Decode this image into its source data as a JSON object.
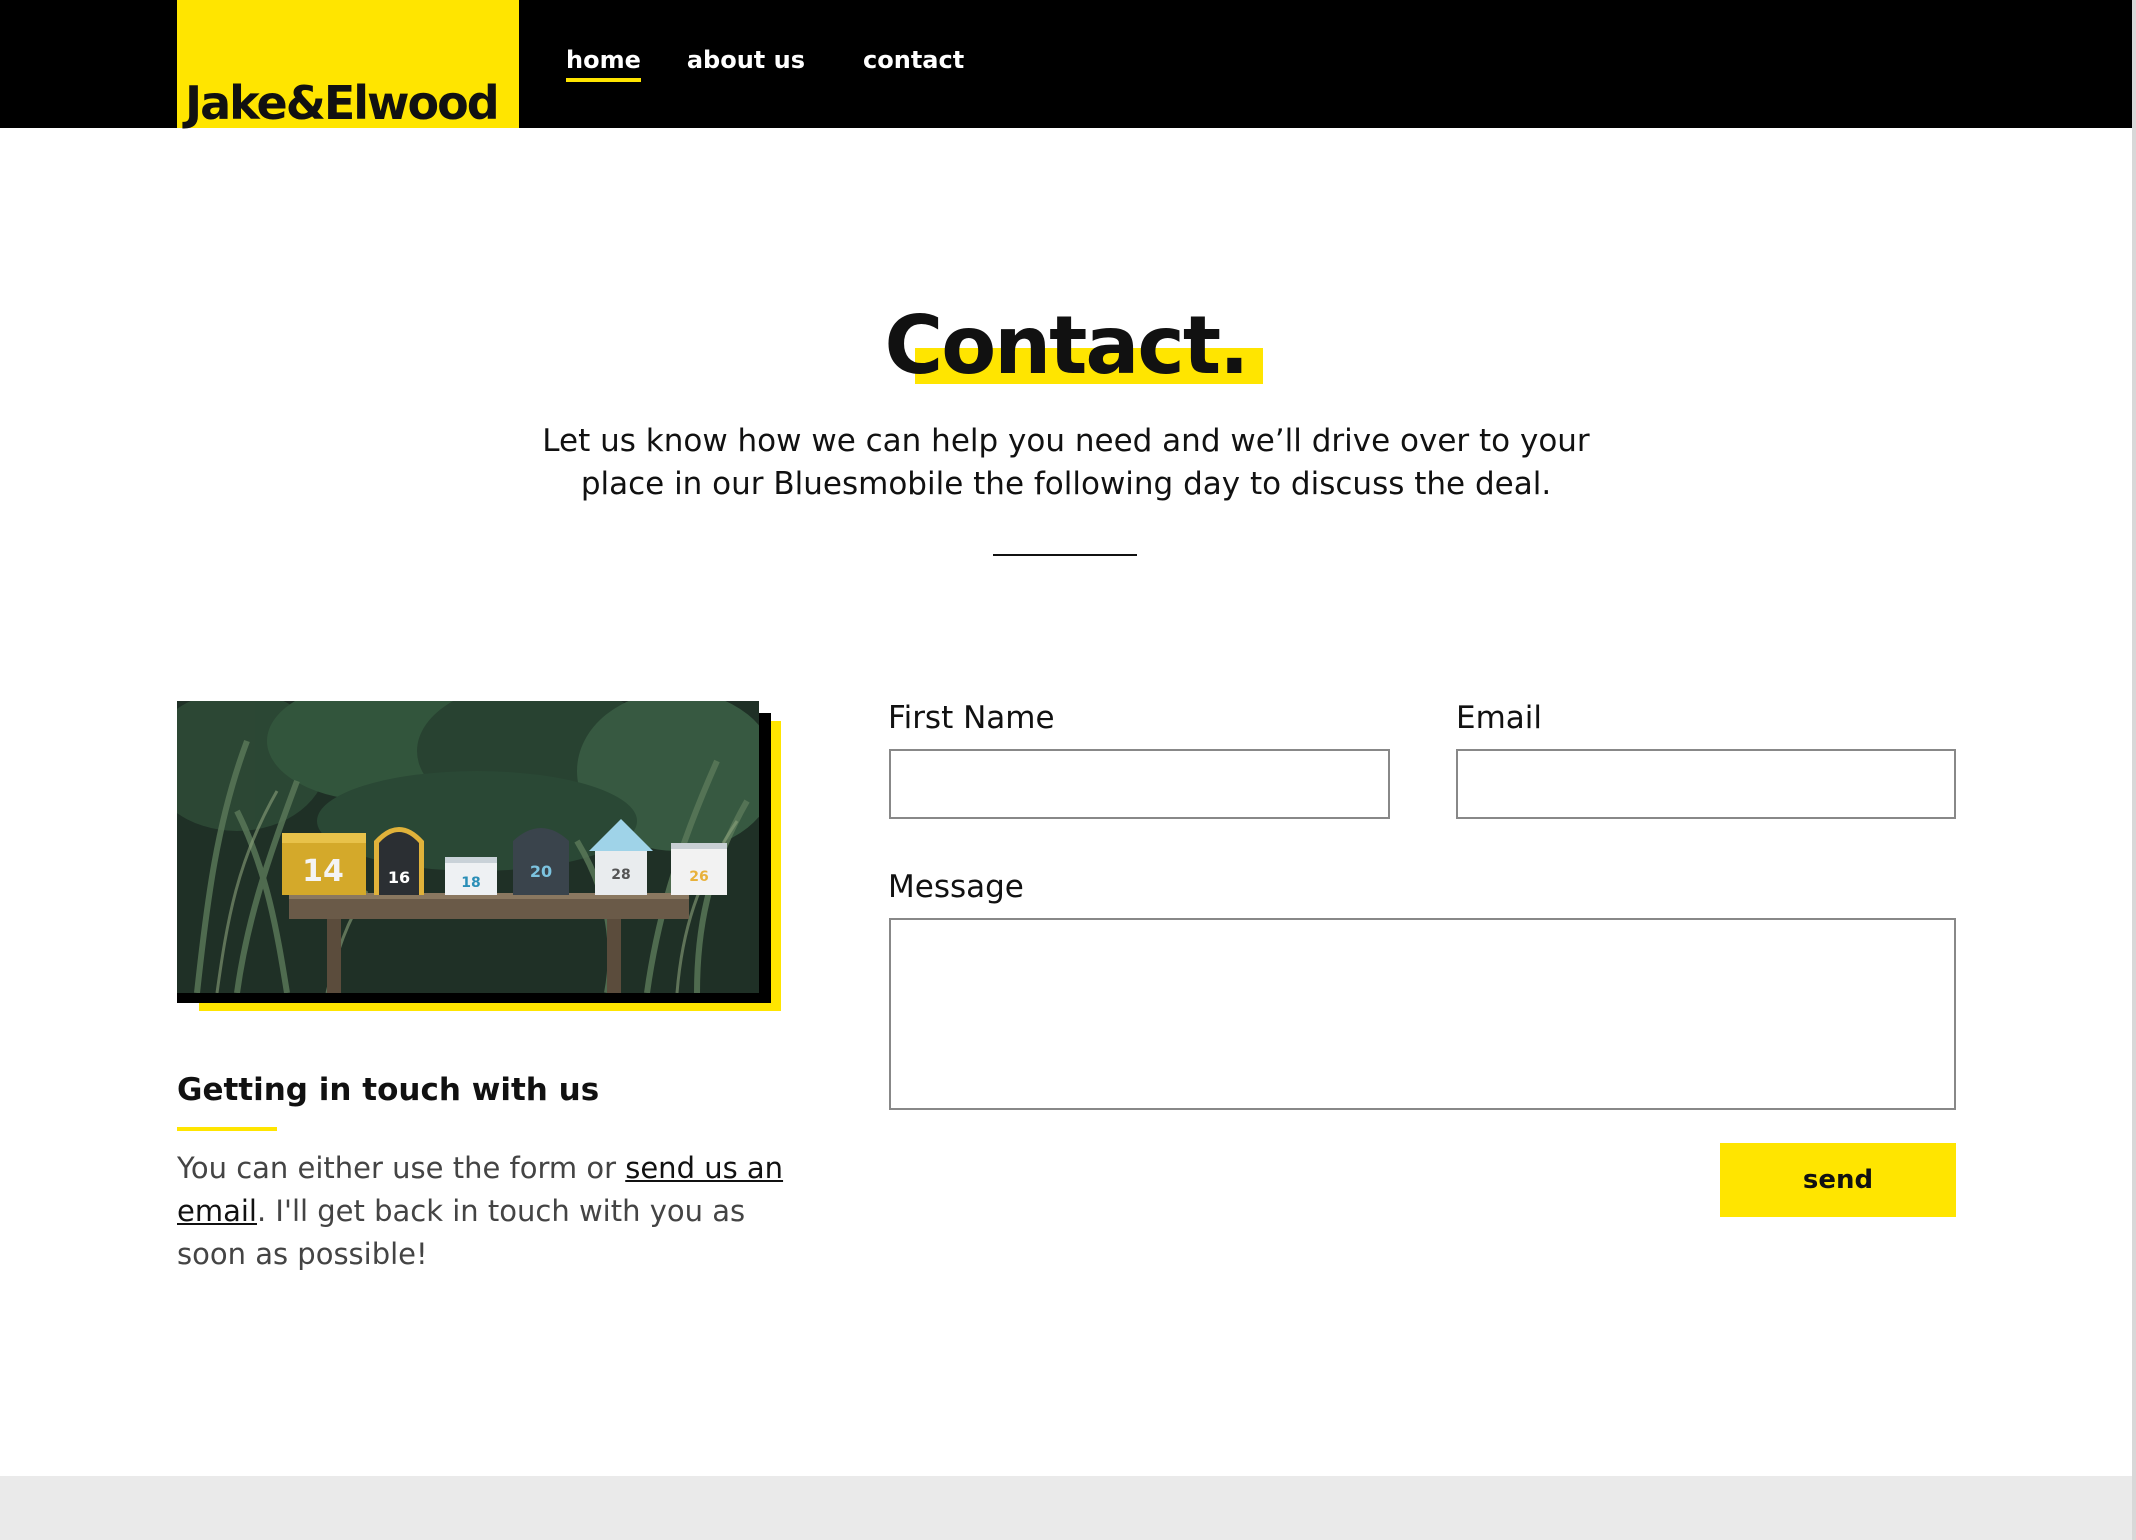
{
  "brand": {
    "logo_text": "Jake&Elwood"
  },
  "nav": {
    "items": [
      {
        "label": "home",
        "active": true
      },
      {
        "label": "about us",
        "active": false
      },
      {
        "label": "contact",
        "active": false
      }
    ]
  },
  "hero": {
    "title": "Contact.",
    "intro_lines": [
      "Let us know how we can help you need and we’ll drive over to your",
      "place in our Bluesmobile the following day to discuss the deal."
    ]
  },
  "photo": {
    "mailbox_numbers": [
      "14",
      "16",
      "18",
      "20",
      "28",
      "26"
    ]
  },
  "side": {
    "heading": "Getting in touch with us",
    "text_before": "You can either use the form or ",
    "link_text": "send us an email",
    "text_after": ". I'll get back in touch with you as soon as possible!"
  },
  "form": {
    "first_name_label": "First Name",
    "first_name_value": "",
    "email_label": "Email",
    "email_value": "",
    "message_label": "Message",
    "message_value": "",
    "send_label": "send"
  },
  "colors": {
    "accent": "#ffe500",
    "header_bg": "#000000",
    "footer_bg": "#eaeaea"
  }
}
